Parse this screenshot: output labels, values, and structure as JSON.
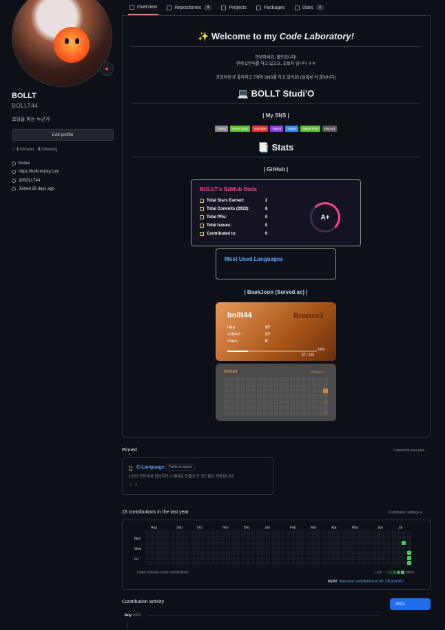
{
  "nav": {
    "tabs": [
      {
        "label": "Overview",
        "icon": "book-icon"
      },
      {
        "label": "Repositories",
        "count": "3",
        "icon": "repo-icon"
      },
      {
        "label": "Projects",
        "icon": "project-icon"
      },
      {
        "label": "Packages",
        "icon": "package-icon"
      },
      {
        "label": "Stars",
        "count": "2",
        "icon": "star-icon"
      }
    ]
  },
  "profile": {
    "name": "BOLLT",
    "login": "BOLLT44",
    "bio": "코딩을 하는 누군가",
    "edit_label": "Edit profile",
    "followers": "1",
    "followers_label": "follower",
    "following": "2",
    "following_label": "following",
    "location": "Korea",
    "website": "https://bollt.tistoty.com",
    "twitter": "@BOLLT44",
    "joined": "Joined 26 days ago"
  },
  "readme": {
    "welcome_prefix": "✨ Welcome to my ",
    "welcome_em": "Code Laboratory!",
    "intro1": "안녕하세요, 볼트입니다!",
    "intro2": "현재 C언어를 하고 있고요, 초보자 입니다 ㅎㅎ",
    "intro3": "코딩이랑 IT 좋아하고 7개의 SNS를 하고 있어요! (실제론 더 많답니다)",
    "studio_title": "💻 BOLLT Studi'O",
    "sns_header": "| My SNS |",
    "badges": [
      {
        "label": "Tistory",
        "color": "#8b8b8b"
      },
      {
        "label": "Never Blog",
        "color": "#5ec230"
      },
      {
        "label": "YouTube",
        "color": "#e53935"
      },
      {
        "label": "Twitch",
        "color": "#8a3ee8"
      },
      {
        "label": "Twitter",
        "color": "#2d8fe6"
      },
      {
        "label": "Naver Post",
        "color": "#5ec230"
      },
      {
        "label": "Discord",
        "color": "#5b5b5b"
      }
    ],
    "stats_title": "📑 Stats",
    "github_header": "| GitHub |",
    "baekjoon_header": "| BaekJoon (Solved.ac) |"
  },
  "stats_card": {
    "title": "BOLLT's GitHub Stats",
    "rows": [
      {
        "label": "Total Stars Earned:",
        "value": "2"
      },
      {
        "label": "Total Commits (2022):",
        "value": "8"
      },
      {
        "label": "Total PRs:",
        "value": "0"
      },
      {
        "label": "Total Issues:",
        "value": "0"
      },
      {
        "label": "Contributed to:",
        "value": "0"
      }
    ],
    "grade": "A+",
    "title_color": "#fe428e",
    "accent_color": "#fe428e"
  },
  "lang_card": {
    "title": "Most Used Languages"
  },
  "solved_card": {
    "handle": "bollt44",
    "tier": "Bronze3",
    "rows": [
      {
        "label": "rate",
        "value": "97"
      },
      {
        "label": "solved",
        "value": "27"
      },
      {
        "label": "class",
        "value": "0"
      }
    ],
    "percent": "23%",
    "progress_text": "97 / 120",
    "progress": 0.23
  },
  "grass_card": {
    "handle": "bollt44",
    "tier": "Bronze 3"
  },
  "pinned": {
    "header": "Pinned",
    "customize": "Customize your pins",
    "repo_name": "C-Language",
    "repo_badge": "Public template",
    "repo_desc": "C언어 전반에서 연습하거나 재미로 만들어 곤 코드들이 저장됩니다!",
    "repo_stars": "1"
  },
  "contributions": {
    "header": "15 contributions in the last year",
    "settings": "Contribution settings ▾",
    "months": [
      "Aug",
      "Sep",
      "Oct",
      "Nov",
      "Dec",
      "Jan",
      "Feb",
      "Mar",
      "Apr",
      "May",
      "Jun",
      "Jul"
    ],
    "days": [
      "Mon",
      "Wed",
      "Fri"
    ],
    "learn": "Learn how we count contributions",
    "less": "Less",
    "more": "More",
    "new_label": "NEW!",
    "new_link": "View your contributions in 3D, VR and IRL!"
  },
  "activity": {
    "header": "Contribution activity",
    "year": "2022",
    "month": "July",
    "month_year": "2022"
  }
}
